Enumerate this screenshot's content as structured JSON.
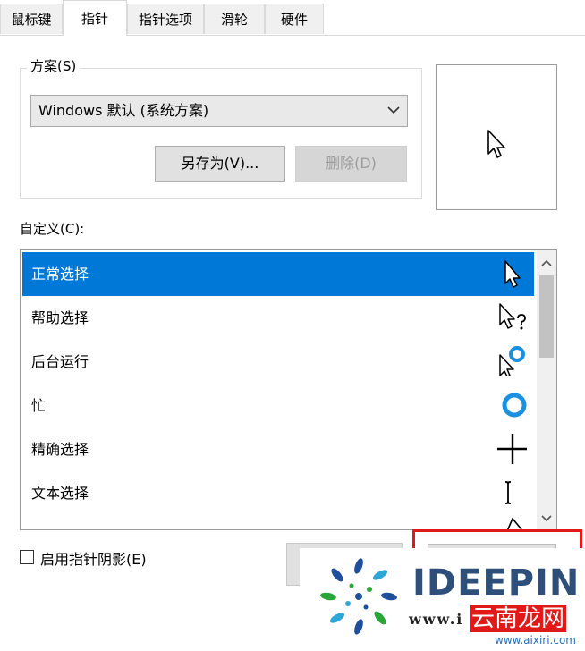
{
  "tabs": [
    {
      "label": "鼠标键",
      "active": false
    },
    {
      "label": "指针",
      "active": true
    },
    {
      "label": "指针选项",
      "active": false
    },
    {
      "label": "滑轮",
      "active": false
    },
    {
      "label": "硬件",
      "active": false
    }
  ],
  "scheme": {
    "legend": "方案(S)",
    "selected": "Windows 默认 (系统方案)",
    "save_as_label": "另存为(V)...",
    "delete_label": "删除(D)"
  },
  "custom": {
    "label": "自定义(C):",
    "items": [
      {
        "label": "正常选择",
        "icon": "arrow-cursor-icon",
        "selected": true
      },
      {
        "label": "帮助选择",
        "icon": "help-cursor-icon",
        "selected": false
      },
      {
        "label": "后台运行",
        "icon": "working-in-background-cursor-icon",
        "selected": false
      },
      {
        "label": "忙",
        "icon": "busy-cursor-icon",
        "selected": false
      },
      {
        "label": "精确选择",
        "icon": "crosshair-cursor-icon",
        "selected": false
      },
      {
        "label": "文本选择",
        "icon": "text-beam-cursor-icon",
        "selected": false
      }
    ]
  },
  "shadow": {
    "label": "启用指针阴影(E)",
    "checked": false
  },
  "watermark": {
    "title": "IDEEPIN",
    "url": "www.i",
    "site_name": "云南龙网",
    "site_url": "www.aixiri.com"
  },
  "colors": {
    "selection": "#0078d7",
    "highlight_border": "#e21919",
    "busy_ring": "#1b8fe0"
  }
}
